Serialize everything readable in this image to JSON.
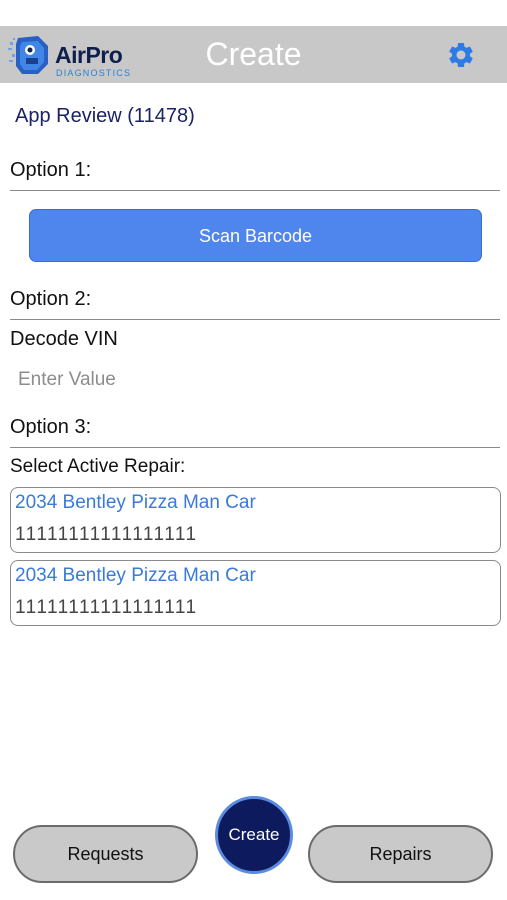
{
  "header": {
    "logo": {
      "wordmark": "AirPro",
      "subtitle": "DIAGNOSTICS"
    },
    "title": "Create",
    "settings_icon": "gear-icon"
  },
  "account": "App Review (11478)",
  "option1": {
    "label": "Option 1:",
    "button_label": "Scan Barcode"
  },
  "option2": {
    "label": "Option 2:",
    "field_label": "Decode VIN",
    "placeholder": "Enter Value",
    "value": ""
  },
  "option3": {
    "label": "Option 3:",
    "list_label": "Select Active Repair:",
    "repairs": [
      {
        "title": "2034 Bentley Pizza Man Car",
        "vin": "11111111111111111"
      },
      {
        "title": "2034 Bentley Pizza Man Car",
        "vin": "11111111111111111"
      }
    ]
  },
  "bottom_nav": {
    "left": "Requests",
    "center": "Create",
    "right": "Repairs"
  },
  "colors": {
    "header_bg": "#c8c8c8",
    "accent_blue": "#4f86ee",
    "navy": "#0d1a5e",
    "link_blue": "#3a7ad8"
  }
}
